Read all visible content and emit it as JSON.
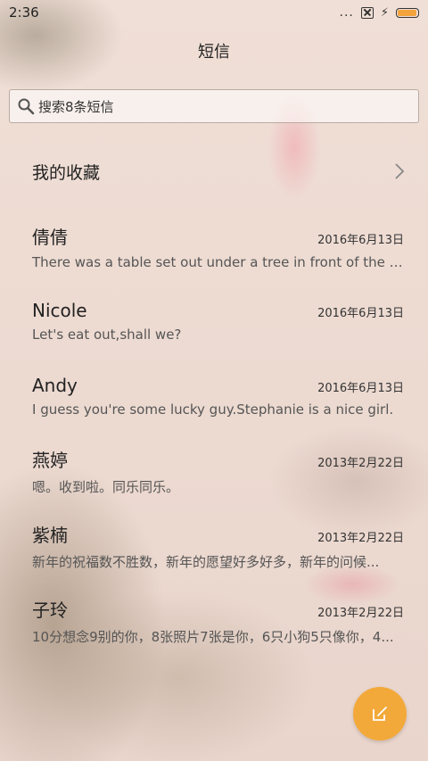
{
  "status_bar": {
    "time": "2:36",
    "more": "...",
    "battery_level": 0.95
  },
  "header": {
    "title": "短信"
  },
  "search": {
    "placeholder": "搜索8条短信"
  },
  "favorites": {
    "label": "我的收藏"
  },
  "conversations": [
    {
      "name": "倩倩",
      "date": "2016年6月13日",
      "preview": "There was a table set out under a tree in front of the ho..."
    },
    {
      "name": "Nicole",
      "date": "2016年6月13日",
      "preview": "Let's eat out,shall we?"
    },
    {
      "name": "Andy",
      "date": "2016年6月13日",
      "preview": "I guess you're some lucky guy.Stephanie is a nice girl."
    },
    {
      "name": "燕婷",
      "date": "2013年2月22日",
      "preview": "嗯。收到啦。同乐同乐。"
    },
    {
      "name": "紫楠",
      "date": "2013年2月22日",
      "preview": "新年的祝福数不胜数，新年的愿望好多好多，新年的问候..."
    },
    {
      "name": "子玲",
      "date": "2013年2月22日",
      "preview": "10分想念9别的你，8张照片7张是你，6只小狗5只像你，4..."
    }
  ],
  "fab": {
    "icon": "compose-icon",
    "color": "#f3a93a"
  }
}
